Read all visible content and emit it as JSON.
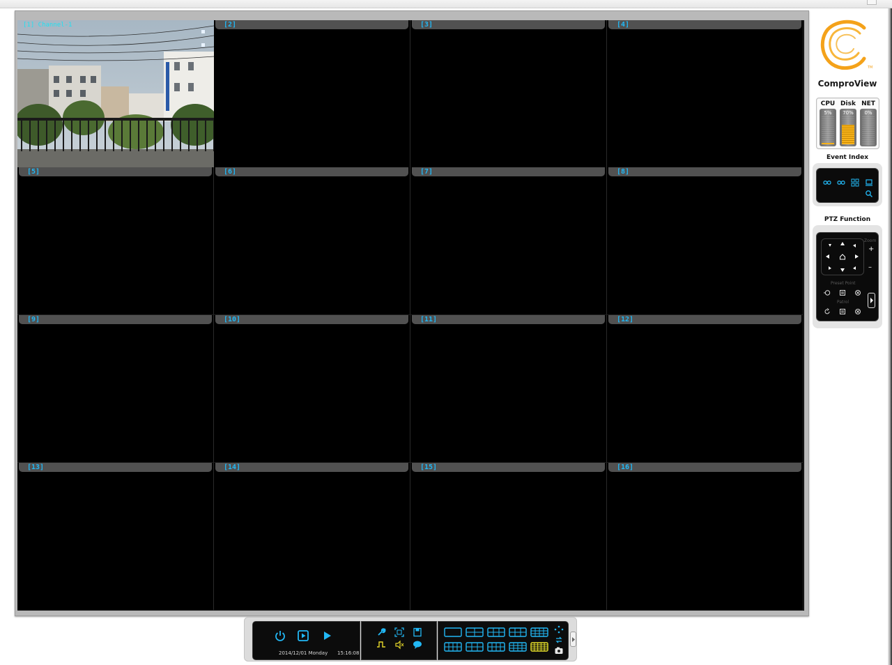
{
  "app": {
    "brand": "ComproView",
    "logo_mark": "TM"
  },
  "grid": {
    "cells": [
      {
        "label": "",
        "active": true
      },
      {
        "label": "[2]"
      },
      {
        "label": "[3]"
      },
      {
        "label": "[4]"
      },
      {
        "label": "[5]"
      },
      {
        "label": "[6]"
      },
      {
        "label": "[7]"
      },
      {
        "label": "[8]"
      },
      {
        "label": "[9]"
      },
      {
        "label": "[10]"
      },
      {
        "label": "[11]"
      },
      {
        "label": "[12]"
      },
      {
        "label": "[13]"
      },
      {
        "label": "[14]"
      },
      {
        "label": "[15]"
      },
      {
        "label": "[16]"
      }
    ],
    "live_title": "[1] Channel-1"
  },
  "meters": [
    {
      "name": "CPU",
      "value": "5%",
      "level": 0.05
    },
    {
      "name": "Disk",
      "value": "70%",
      "level": 0.7
    },
    {
      "name": "NET",
      "value": "0%",
      "level": 0.0
    }
  ],
  "event_index": {
    "title": "Event Index"
  },
  "ptz": {
    "title": "PTZ Function",
    "zoom_label": "Zoom",
    "zoom_in": "+",
    "zoom_out": "–",
    "preset_label": "Preset Point",
    "patrol_label": "Patrol"
  },
  "toolbar": {
    "date": "2014/12/01 Monday",
    "time": "15:16:08"
  },
  "colors": {
    "accent": "#22b8f5",
    "highlight": "#e6e02a",
    "logo": "#f4a21a"
  }
}
